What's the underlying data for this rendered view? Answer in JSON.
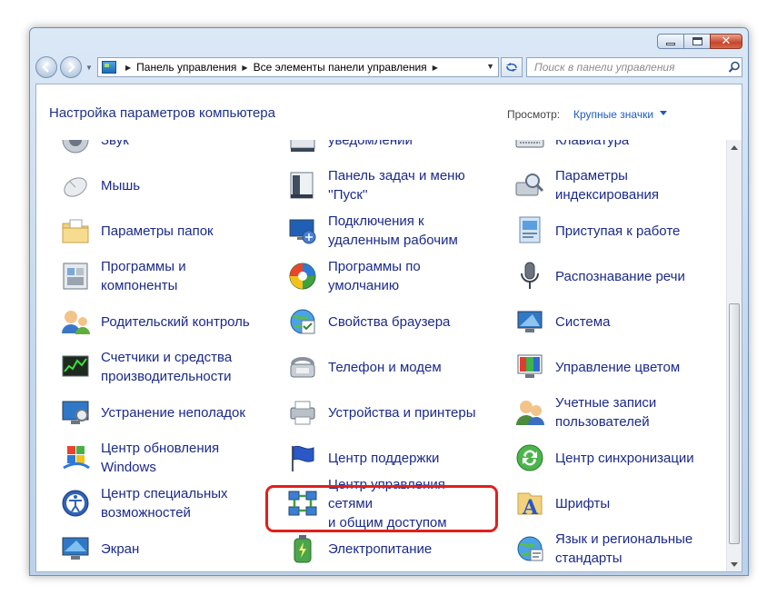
{
  "window": {
    "caption_buttons": [
      "minimize",
      "maximize",
      "close"
    ]
  },
  "navigation": {
    "breadcrumbs": [
      "Панель управления",
      "Все элементы панели управления"
    ],
    "search_placeholder": "Поиск в панели управления"
  },
  "header": {
    "title": "Настройка параметров компьютера",
    "view_label": "Просмотр:",
    "view_value": "Крупные значки"
  },
  "items": [
    {
      "id": "sound",
      "label": "Звук",
      "icon": "speaker-icon"
    },
    {
      "id": "notifications",
      "label": "уведомлений",
      "icon": "notification-area-icon"
    },
    {
      "id": "keyboard",
      "label": "Клавиатура",
      "icon": "keyboard-icon"
    },
    {
      "id": "mouse",
      "label": "Мышь",
      "icon": "mouse-icon"
    },
    {
      "id": "taskbar",
      "label": "Панель задач и меню\n''Пуск''",
      "icon": "taskbar-icon"
    },
    {
      "id": "indexing",
      "label": "Параметры\nиндексирования",
      "icon": "indexing-icon"
    },
    {
      "id": "folder-options",
      "label": "Параметры папок",
      "icon": "folder-icon"
    },
    {
      "id": "remoteapp",
      "label": "Подключения к\nудаленным рабочим",
      "icon": "remote-desktop-icon"
    },
    {
      "id": "getting-started",
      "label": "Приступая к работе",
      "icon": "getting-started-icon"
    },
    {
      "id": "programs",
      "label": "Программы и\nкомпоненты",
      "icon": "programs-icon"
    },
    {
      "id": "default-programs",
      "label": "Программы по\nумолчанию",
      "icon": "default-programs-icon"
    },
    {
      "id": "speech",
      "label": "Распознавание речи",
      "icon": "microphone-icon"
    },
    {
      "id": "parental",
      "label": "Родительский контроль",
      "icon": "parental-control-icon"
    },
    {
      "id": "internet-options",
      "label": "Свойства браузера",
      "icon": "internet-options-icon"
    },
    {
      "id": "system",
      "label": "Система",
      "icon": "system-icon"
    },
    {
      "id": "performance",
      "label": "Счетчики и средства\nпроизводительности",
      "icon": "performance-icon"
    },
    {
      "id": "phone-modem",
      "label": "Телефон и модем",
      "icon": "phone-modem-icon"
    },
    {
      "id": "color-management",
      "label": "Управление цветом",
      "icon": "color-management-icon"
    },
    {
      "id": "troubleshooting",
      "label": "Устранение неполадок",
      "icon": "troubleshooting-icon"
    },
    {
      "id": "devices-printers",
      "label": "Устройства и принтеры",
      "icon": "devices-printers-icon"
    },
    {
      "id": "user-accounts",
      "label": "Учетные записи\nпользователей",
      "icon": "user-accounts-icon"
    },
    {
      "id": "windows-update",
      "label": "Центр обновления\nWindows",
      "icon": "windows-update-icon"
    },
    {
      "id": "action-center",
      "label": "Центр поддержки",
      "icon": "action-center-flag-icon"
    },
    {
      "id": "sync-center",
      "label": "Центр синхронизации",
      "icon": "sync-center-icon"
    },
    {
      "id": "ease-of-access",
      "label": "Центр специальных\nвозможностей",
      "icon": "ease-of-access-icon"
    },
    {
      "id": "network-sharing",
      "label": "Центр управления сетями\nи общим доступом",
      "icon": "network-icon"
    },
    {
      "id": "fonts",
      "label": "Шрифты",
      "icon": "fonts-icon"
    },
    {
      "id": "display",
      "label": "Экран",
      "icon": "display-icon"
    },
    {
      "id": "power",
      "label": "Электропитание",
      "icon": "power-options-icon"
    },
    {
      "id": "region-language",
      "label": "Язык и региональные\nстандарты",
      "icon": "region-language-icon"
    }
  ],
  "highlighted_item": "network-sharing",
  "colors": {
    "link_text": "#1b2a8a",
    "header_title": "#1e3287",
    "highlight_border": "#e0201c"
  }
}
